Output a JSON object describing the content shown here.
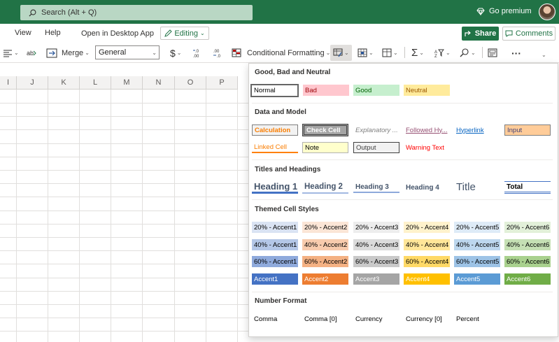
{
  "top": {
    "search_placeholder": "Search (Alt + Q)",
    "premium": "Go premium"
  },
  "menu": {
    "view": "View",
    "help": "Help",
    "open_desktop": "Open in Desktop App",
    "editing": "Editing",
    "share": "Share",
    "comments": "Comments"
  },
  "ribbon": {
    "merge": "Merge",
    "number_format": "General",
    "currency_symbol": "$",
    "conditional_formatting": "Conditional Formatting",
    "sum_symbol": "Σ",
    "more": "···"
  },
  "columns": [
    "I",
    "J",
    "K",
    "L",
    "M",
    "N",
    "O",
    "P"
  ],
  "sections": {
    "gbn": "Good, Bad and Neutral",
    "dm": "Data and Model",
    "th": "Titles and Headings",
    "tcs": "Themed Cell Styles",
    "nf": "Number Format"
  },
  "styles": {
    "normal": "Normal",
    "bad": "Bad",
    "good": "Good",
    "neutral": "Neutral",
    "calculation": "Calculation",
    "check_cell": "Check Cell",
    "explanatory": "Explanatory ...",
    "followed": "Followed Hy...",
    "hyperlink": "Hyperlink",
    "input": "Input",
    "linked_cell": "Linked Cell",
    "note": "Note",
    "output": "Output",
    "warning": "Warning Text",
    "h1": "Heading 1",
    "h2": "Heading 2",
    "h3": "Heading 3",
    "h4": "Heading 4",
    "title": "Title",
    "total": "Total"
  },
  "themed": {
    "r20": [
      "20% - Accent1",
      "20% - Accent2",
      "20% - Accent3",
      "20% - Accent4",
      "20% - Accent5",
      "20% - Accent6"
    ],
    "r40": [
      "40% - Accent1",
      "40% - Accent2",
      "40% - Accent3",
      "40% - Accent4",
      "40% - Accent5",
      "40% - Accent6"
    ],
    "r60": [
      "60% - Accent1",
      "60% - Accent2",
      "60% - Accent3",
      "60% - Accent4",
      "60% - Accent5",
      "60% - Accent6"
    ],
    "acc": [
      "Accent1",
      "Accent2",
      "Accent3",
      "Accent4",
      "Accent5",
      "Accent6"
    ]
  },
  "number_formats": [
    "Comma",
    "Comma [0]",
    "Currency",
    "Currency [0]",
    "Percent"
  ],
  "colors": {
    "brand": "#217346",
    "accent1": "#4472c4",
    "accent2": "#ed7d31",
    "accent3": "#a5a5a5",
    "accent4": "#ffc000",
    "accent5": "#5b9bd5",
    "accent6": "#70ad47"
  }
}
